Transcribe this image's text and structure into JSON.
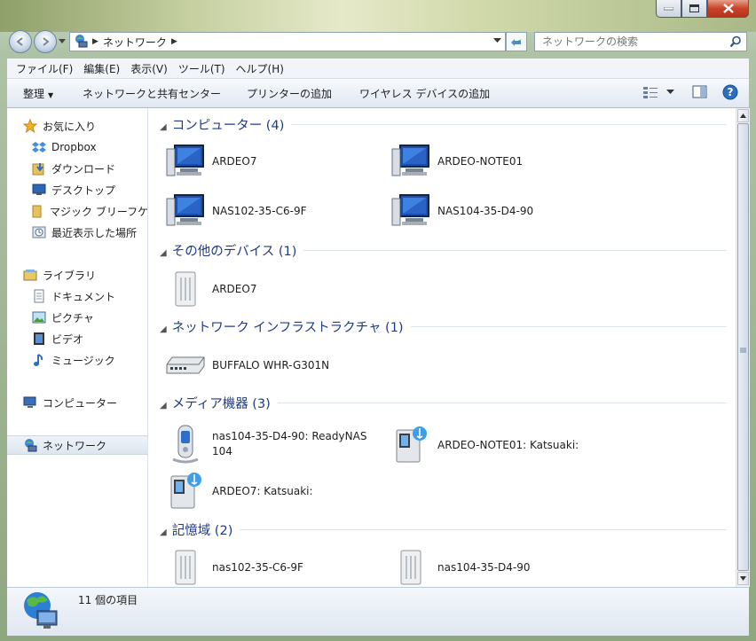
{
  "window": {
    "minimize_label": "minimize",
    "maximize_label": "maximize",
    "close_label": "close"
  },
  "address": {
    "path": "ネットワーク",
    "search_placeholder": "ネットワークの検索"
  },
  "menu": [
    "ファイル(F)",
    "編集(E)",
    "表示(V)",
    "ツール(T)",
    "ヘルプ(H)"
  ],
  "toolbar": {
    "organize": "整理",
    "network_center": "ネットワークと共有センター",
    "add_printer": "プリンターの追加",
    "add_wireless": "ワイヤレス デバイスの追加"
  },
  "navpane": {
    "favorites": "お気に入り",
    "dropbox": "Dropbox",
    "downloads": "ダウンロード",
    "desktop": "デスクトップ",
    "magic_briefcase": "マジック ブリーフケ",
    "recent": "最近表示した場所",
    "libraries": "ライブラリ",
    "documents": "ドキュメント",
    "pictures": "ピクチャ",
    "videos": "ビデオ",
    "music": "ミュージック",
    "computer": "コンピューター",
    "network": "ネットワーク"
  },
  "groups": {
    "computers": "コンピューター (4)",
    "other_devices": "その他のデバイス (1)",
    "infrastructure": "ネットワーク インフラストラクチャ (1)",
    "media": "メディア機器 (3)",
    "storage": "記憶域 (2)"
  },
  "items": {
    "computers": [
      "ARDEO7",
      "ARDEO-NOTE01",
      "NAS102-35-C6-9F",
      "NAS104-35-D4-90"
    ],
    "other_devices": [
      "ARDEO7"
    ],
    "infrastructure": [
      "BUFFALO WHR-G301N"
    ],
    "media": [
      "nas104-35-D4-90: ReadyNAS 104",
      "ARDEO-NOTE01: Katsuaki:",
      "ARDEO7: Katsuaki:"
    ],
    "storage": [
      "nas102-35-C6-9F",
      "nas104-35-D4-90"
    ]
  },
  "status": {
    "count": "11 個の項目"
  },
  "icons": {
    "computer": "computer-icon",
    "network": "network-icon",
    "nas": "nas-icon",
    "router": "router-icon",
    "media_server": "media-server-icon",
    "phone": "media-phone-icon"
  }
}
